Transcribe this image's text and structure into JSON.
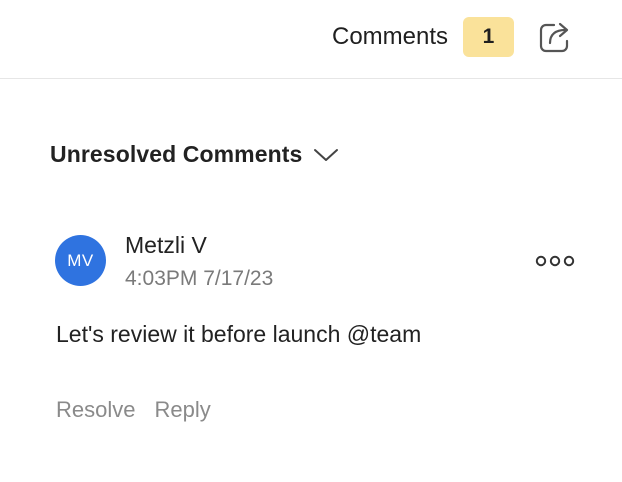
{
  "header": {
    "title": "Comments",
    "count": "1",
    "share_icon": "share-icon",
    "badge_color": "#fae29a"
  },
  "section": {
    "title": "Unresolved Comments",
    "toggle_icon": "chevron-down-icon"
  },
  "comment": {
    "avatar_initials": "MV",
    "avatar_color": "#2f73e0",
    "author": "Metzli V",
    "timestamp": "4:03PM 7/17/23",
    "text": "Let's review it before launch @team",
    "more_icon": "more-options-icon",
    "actions": {
      "resolve": "Resolve",
      "reply": "Reply"
    }
  }
}
